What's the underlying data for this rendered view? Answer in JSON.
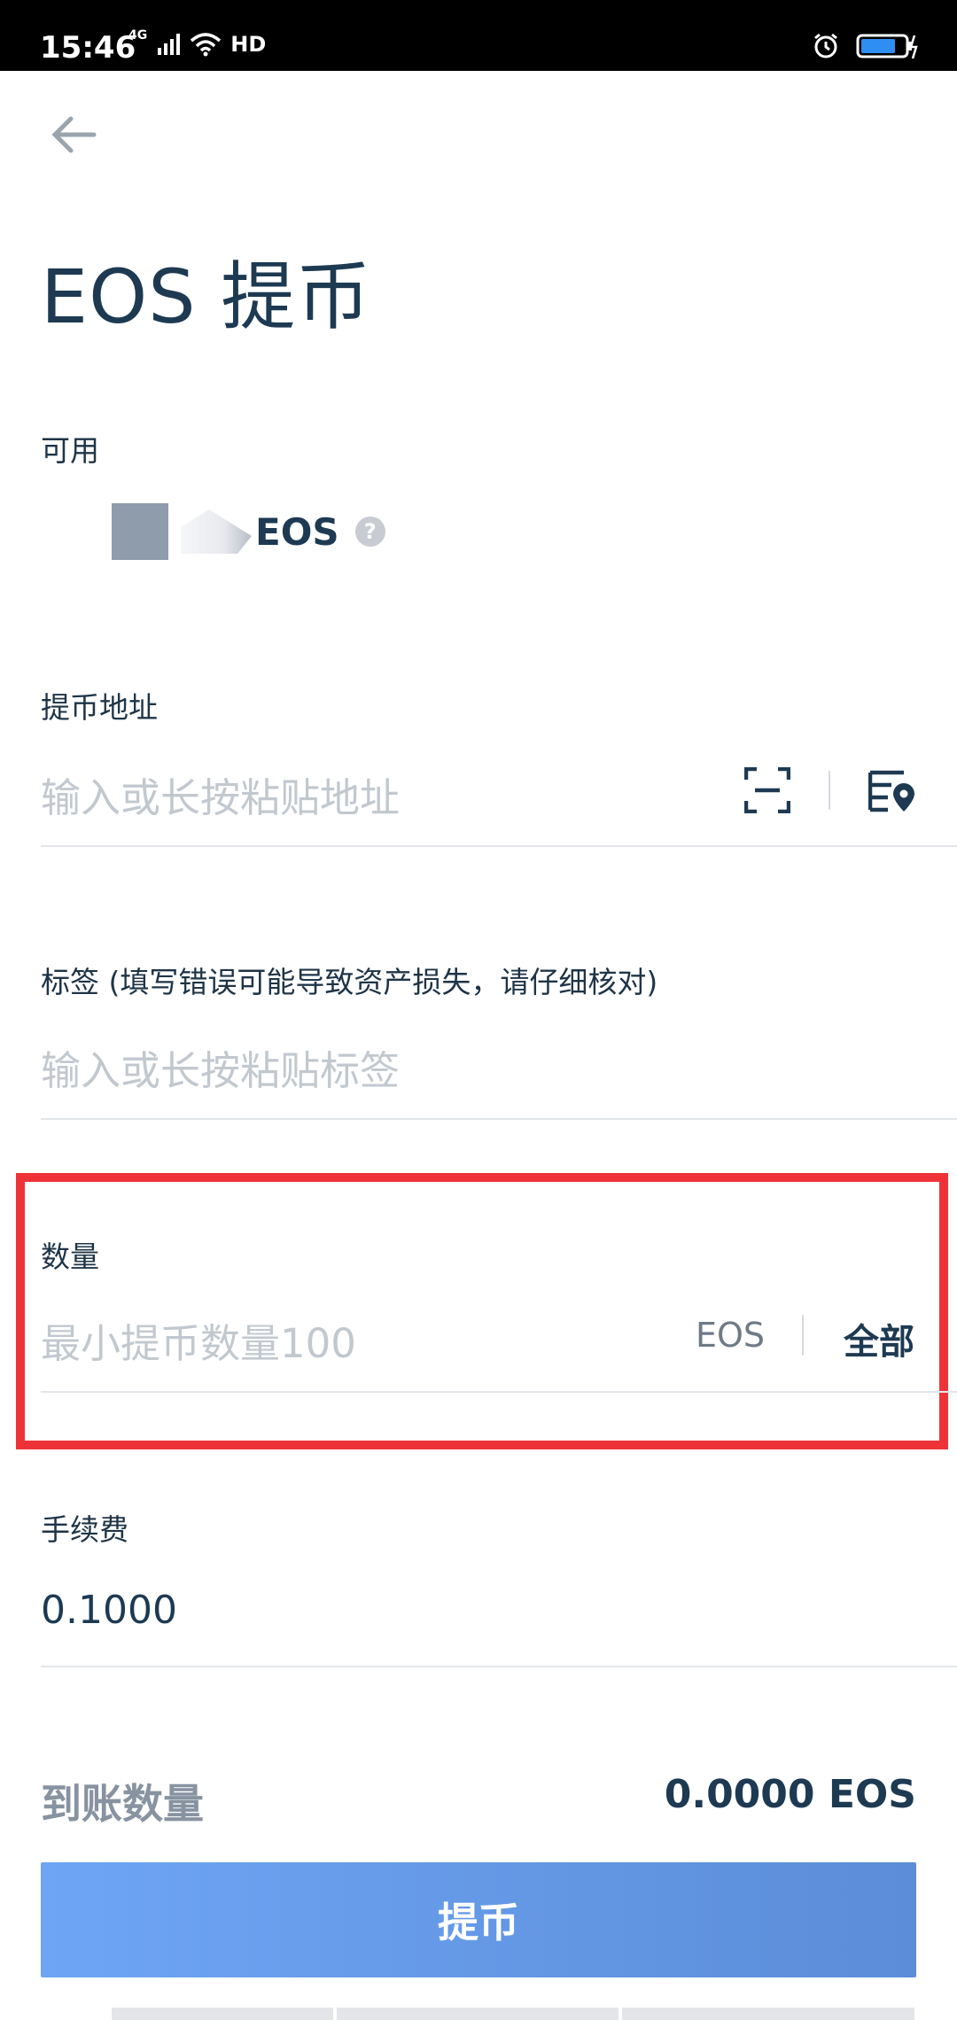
{
  "status_bar": {
    "time": "15:46",
    "network": "4G",
    "hd": "HD",
    "icons": [
      "signal-icon",
      "wifi-icon",
      "alarm-icon",
      "battery-icon"
    ]
  },
  "header": {
    "back_icon": "arrow-left-icon",
    "title": "EOS 提币"
  },
  "available": {
    "label": "可用",
    "unit": "EOS",
    "help_icon": "?"
  },
  "address": {
    "label": "提币地址",
    "placeholder": "输入或长按粘贴地址",
    "scan_icon": "scan-icon",
    "book_icon": "address-book-icon"
  },
  "memo": {
    "label": "标签 (填写错误可能导致资产损失，请仔细核对)",
    "placeholder": "输入或长按粘贴标签"
  },
  "amount": {
    "label": "数量",
    "placeholder": "最小提币数量100",
    "unit": "EOS",
    "all_label": "全部"
  },
  "fee": {
    "label": "手续费",
    "value": "0.1000"
  },
  "receive": {
    "label": "到账数量",
    "value": "0.0000 EOS"
  },
  "submit": {
    "label": "提币"
  },
  "colors": {
    "primary_text": "#1d3a52",
    "placeholder": "#c2c8cf",
    "highlight": "#ee3338",
    "button_start": "#6ea5f5",
    "button_end": "#5b8dd8"
  }
}
